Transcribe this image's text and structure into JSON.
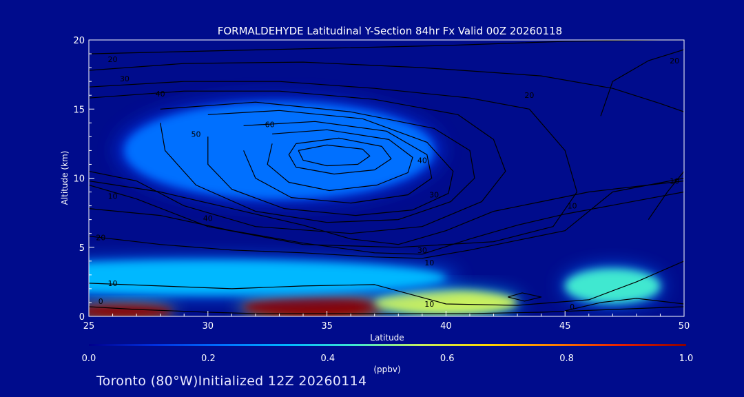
{
  "footer": "Toronto (80°W)Initialized 12Z 20260114",
  "colorbar": {
    "unit": "(ppbv)",
    "ticks": [
      "0.0",
      "0.2",
      "0.4",
      "0.6",
      "0.8",
      "1.0"
    ],
    "colors": [
      "#00008b",
      "#0030e0",
      "#0070ff",
      "#00b8ff",
      "#40e8d0",
      "#c8f060",
      "#ffd800",
      "#ff8000",
      "#e82000",
      "#8b0000"
    ]
  },
  "chart_data": {
    "type": "heatmap",
    "title": "FORMALDEHYDE Latitudinal Y-Section 84hr  Fx Valid 00Z 20260118",
    "xlabel": "Latitude",
    "ylabel": "Altitude (km)",
    "xlim": [
      25,
      50
    ],
    "ylim": [
      0,
      20
    ],
    "x_ticks": [
      "25",
      "30",
      "35",
      "40",
      "45",
      "50"
    ],
    "y_ticks": [
      "0",
      "5",
      "10",
      "15",
      "20"
    ],
    "value_range": [
      0.0,
      1.0
    ],
    "value_unit": "ppbv",
    "grid": false,
    "formaldehyde_features": [
      {
        "center_lat": 34.5,
        "center_alt_km": 0.7,
        "lat_span": [
          31,
          37
        ],
        "alt_span_km": [
          0,
          1.6
        ],
        "value": 1.0
      },
      {
        "center_lat": 26.5,
        "center_alt_km": 0.4,
        "lat_span": [
          25,
          29
        ],
        "alt_span_km": [
          0,
          1.0
        ],
        "value": 0.95
      },
      {
        "center_lat": 40.0,
        "center_alt_km": 1.0,
        "lat_span": [
          37,
          43
        ],
        "alt_span_km": [
          0.2,
          2.0
        ],
        "value": 0.55
      },
      {
        "center_lat": 47.0,
        "center_alt_km": 2.2,
        "lat_span": [
          45,
          49
        ],
        "alt_span_km": [
          1.0,
          3.5
        ],
        "value": 0.45
      },
      {
        "center_lat": 30.0,
        "center_alt_km": 2.8,
        "lat_span": [
          25,
          45
        ],
        "alt_span_km": [
          1.5,
          4.0
        ],
        "value": 0.3
      },
      {
        "center_lat": 33.0,
        "center_alt_km": 12.0,
        "lat_span": [
          25,
          38
        ],
        "alt_span_km": [
          7.0,
          14.0
        ],
        "value": 0.25
      }
    ],
    "contours": [
      {
        "level": "0",
        "lats": [
          25,
          27,
          30,
          32,
          35,
          38,
          41,
          44,
          47,
          50
        ],
        "alts": [
          0.7,
          0.5,
          0.3,
          0.2,
          0.2,
          0.2,
          0.2,
          0.3,
          0.5,
          0.7
        ]
      },
      {
        "level": "0",
        "lats": [
          45,
          46.5,
          48,
          50
        ],
        "alts": [
          0.4,
          1.0,
          1.3,
          0.9
        ]
      },
      {
        "level": "10",
        "lats": [
          25,
          28,
          31,
          34,
          37,
          40,
          43,
          46,
          48,
          50
        ],
        "alts": [
          2.4,
          2.2,
          2.0,
          2.2,
          2.3,
          0.9,
          0.8,
          1.2,
          2.5,
          4.0
        ]
      },
      {
        "level": "20",
        "lats": [
          25,
          28,
          31,
          34,
          37,
          39,
          41,
          43,
          45,
          47,
          50
        ],
        "alts": [
          5.8,
          5.2,
          4.8,
          4.6,
          4.3,
          4.2,
          4.8,
          5.5,
          6.2,
          9.0,
          10.0
        ]
      },
      {
        "level": "30",
        "lats": [
          25,
          28,
          31,
          34,
          37,
          39,
          41,
          43,
          45,
          50
        ],
        "alts": [
          7.8,
          7.3,
          6.2,
          5.3,
          4.6,
          4.5,
          5.6,
          6.6,
          7.4,
          9.0
        ]
      },
      {
        "level": "40",
        "lats": [
          25,
          28,
          31,
          34,
          36,
          38,
          40,
          42,
          44,
          46,
          50
        ],
        "alts": [
          9.8,
          9.0,
          7.8,
          6.6,
          5.6,
          5.2,
          6.2,
          7.6,
          8.3,
          9.0,
          9.8
        ]
      },
      {
        "level": "20",
        "lats": [
          25,
          30,
          35,
          40,
          45,
          49,
          50
        ],
        "alts": [
          19.0,
          19.2,
          19.4,
          19.6,
          19.9,
          20.0,
          20.0
        ]
      },
      {
        "level": "30",
        "lats": [
          25,
          29,
          34,
          39,
          44,
          47,
          49,
          50
        ],
        "alts": [
          17.8,
          18.3,
          18.4,
          18.0,
          17.4,
          16.5,
          15.4,
          14.8
        ]
      },
      {
        "level": "40",
        "lats": [
          25,
          29,
          33,
          37,
          41,
          43.5,
          45,
          45.5,
          44.5,
          42,
          38,
          34,
          30,
          27,
          25
        ],
        "alts": [
          16.6,
          17.0,
          17.0,
          16.5,
          15.8,
          15.0,
          12.0,
          9.0,
          6.5,
          5.4,
          5.0,
          5.2,
          6.5,
          8.5,
          9.5
        ]
      },
      {
        "level": "40",
        "lats": [
          25,
          29,
          33,
          37,
          40.5,
          42,
          42.5,
          41.5,
          39,
          36,
          32,
          29,
          27,
          25
        ],
        "alts": [
          15.8,
          16.3,
          16.3,
          15.7,
          14.6,
          12.8,
          10.5,
          8.3,
          6.5,
          6.0,
          6.5,
          8.0,
          9.8,
          10.5
        ]
      },
      {
        "level": "50",
        "lats": [
          28,
          32,
          36,
          39.5,
          41,
          41.2,
          40.2,
          38,
          35,
          32,
          29.5,
          28.2,
          28
        ],
        "alts": [
          15.0,
          15.5,
          14.8,
          13.6,
          12.0,
          10.0,
          8.3,
          7.0,
          6.8,
          7.6,
          9.5,
          12.0,
          14.0
        ]
      },
      {
        "level": "60",
        "lats": [
          30,
          33,
          36.5,
          39.2,
          40.3,
          40.1,
          38.6,
          36.2,
          33.2,
          31,
          30,
          30
        ],
        "alts": [
          14.6,
          14.9,
          14.3,
          12.6,
          10.5,
          8.9,
          7.7,
          7.3,
          7.8,
          9.2,
          11.0,
          13.0
        ]
      },
      {
        "level": "60",
        "lats": [
          31.5,
          34.5,
          37.5,
          39.2,
          39.4,
          38.4,
          36.0,
          33.5,
          32.0,
          31.5
        ],
        "alts": [
          13.8,
          14.1,
          13.4,
          11.7,
          10.0,
          8.8,
          8.2,
          8.6,
          10.0,
          12.0
        ]
      },
      {
        "level": "70",
        "lats": [
          32.7,
          35,
          37.6,
          38.6,
          38.4,
          37.1,
          35.1,
          33.4,
          32.5,
          32.7
        ],
        "alts": [
          13.2,
          13.5,
          12.8,
          11.5,
          10.4,
          9.5,
          9.1,
          9.7,
          11.0,
          12.5
        ]
      },
      {
        "level": "80",
        "lats": [
          33.7,
          35.5,
          37.3,
          37.7,
          37.0,
          35.3,
          33.7,
          33.4,
          33.7
        ],
        "alts": [
          12.5,
          12.9,
          12.3,
          11.4,
          10.6,
          10.3,
          10.8,
          11.7,
          12.5
        ]
      },
      {
        "level": "90",
        "lats": [
          33.8,
          35,
          36.5,
          36.8,
          36.3,
          35,
          34,
          33.8
        ],
        "alts": [
          12.0,
          12.4,
          12.1,
          11.6,
          11.0,
          10.9,
          11.3,
          12.0
        ]
      },
      {
        "level": "20",
        "lats": [
          46.5,
          47,
          48.5,
          50
        ],
        "alts": [
          14.5,
          17.0,
          18.5,
          19.3
        ]
      },
      {
        "level": "10",
        "lats": [
          48.5,
          49.3,
          50
        ],
        "alts": [
          7.0,
          9.0,
          10.5
        ]
      },
      {
        "level": "10",
        "lats": [
          42.6,
          43.2,
          44.0,
          43.3,
          42.6
        ],
        "alts": [
          1.4,
          1.7,
          1.4,
          1.1,
          1.4
        ]
      }
    ],
    "contour_labels": [
      {
        "text": "20",
        "lat": 26.0,
        "alt": 18.6
      },
      {
        "text": "30",
        "lat": 26.5,
        "alt": 17.2
      },
      {
        "text": "40",
        "lat": 28.0,
        "alt": 16.1
      },
      {
        "text": "50",
        "lat": 29.5,
        "alt": 13.2
      },
      {
        "text": "60",
        "lat": 32.6,
        "alt": 13.9
      },
      {
        "text": "40",
        "lat": 39.0,
        "alt": 11.3
      },
      {
        "text": "30",
        "lat": 39.5,
        "alt": 8.8
      },
      {
        "text": "20",
        "lat": 43.5,
        "alt": 16.0
      },
      {
        "text": "20",
        "lat": 49.6,
        "alt": 18.5
      },
      {
        "text": "10",
        "lat": 26.0,
        "alt": 8.7
      },
      {
        "text": "40",
        "lat": 30.0,
        "alt": 7.1
      },
      {
        "text": "20",
        "lat": 25.5,
        "alt": 5.7
      },
      {
        "text": "30",
        "lat": 39.0,
        "alt": 4.8
      },
      {
        "text": "10",
        "lat": 39.3,
        "alt": 3.9
      },
      {
        "text": "10",
        "lat": 45.3,
        "alt": 8.0
      },
      {
        "text": "10",
        "lat": 49.6,
        "alt": 9.8
      },
      {
        "text": "10",
        "lat": 26.0,
        "alt": 2.4
      },
      {
        "text": "0",
        "lat": 25.5,
        "alt": 1.1
      },
      {
        "text": "10",
        "lat": 39.3,
        "alt": 0.9
      },
      {
        "text": "0",
        "lat": 45.3,
        "alt": 0.7
      }
    ]
  }
}
